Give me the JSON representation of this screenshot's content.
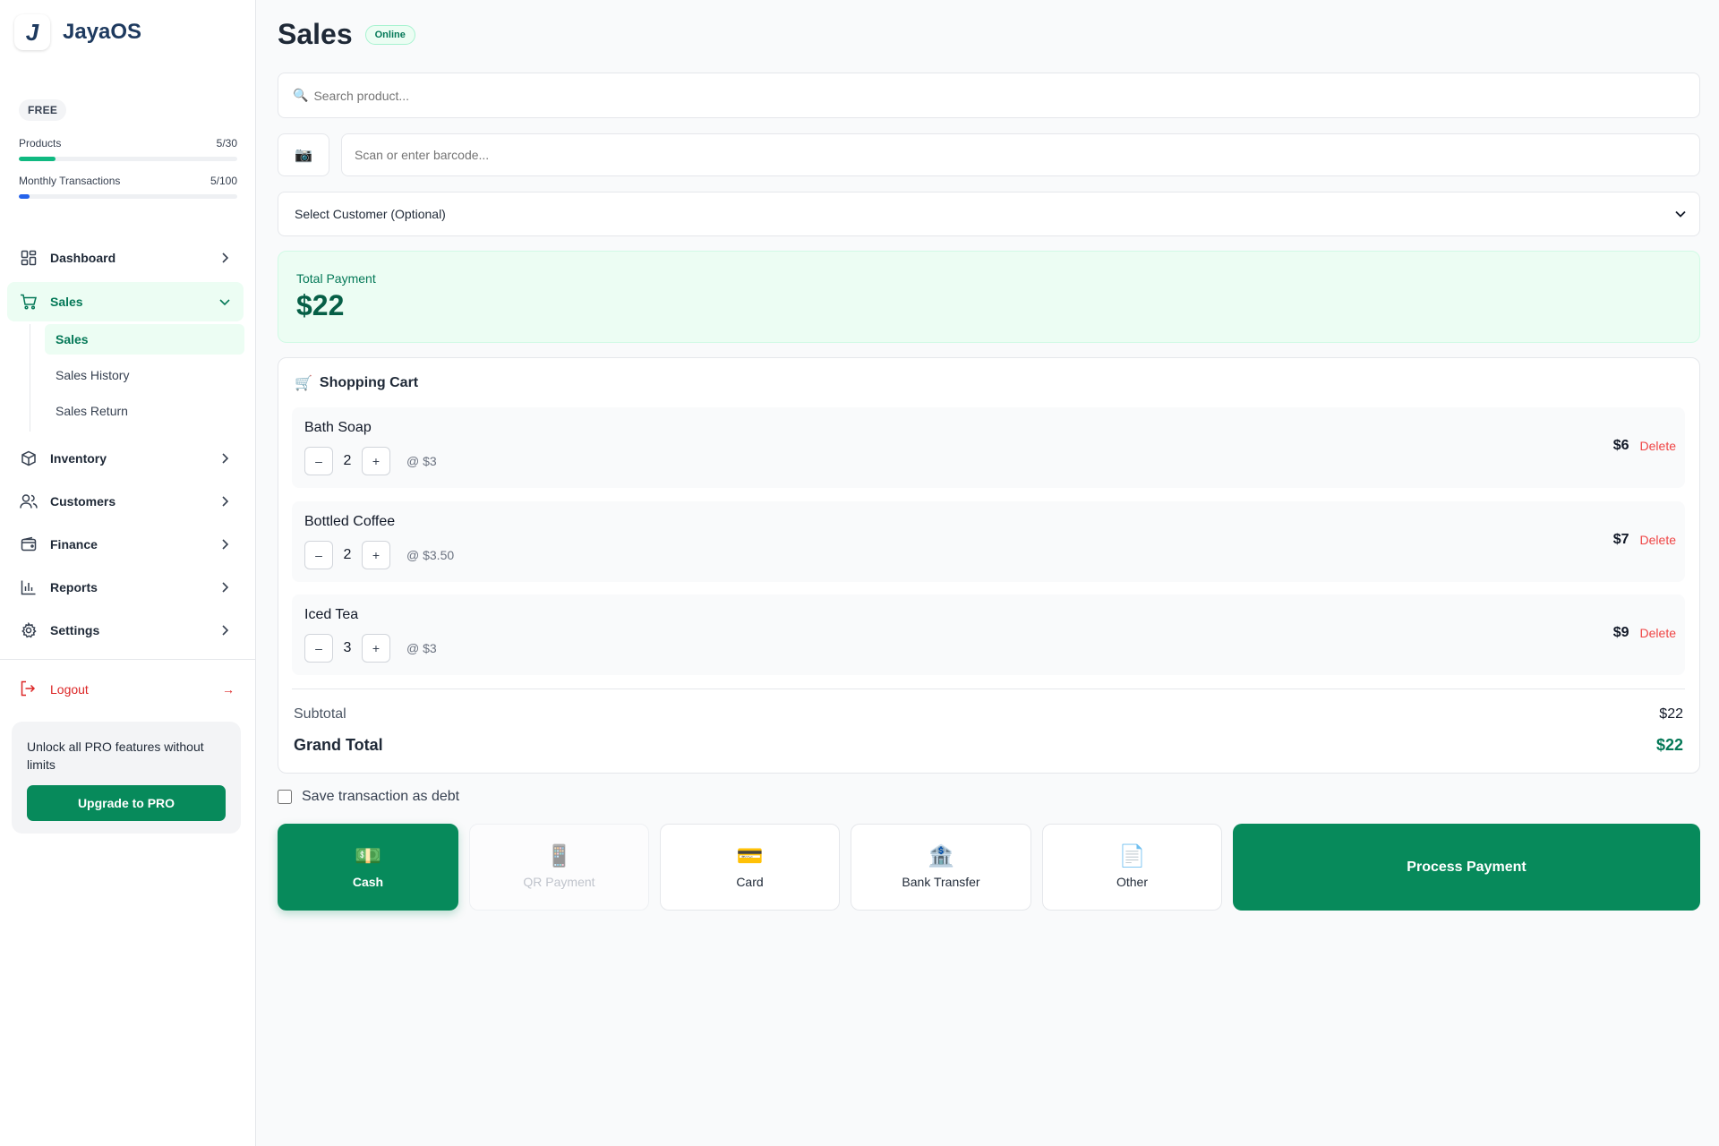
{
  "app": {
    "name": "JayaOS",
    "logo_letter": "J"
  },
  "plan": {
    "badge": "FREE",
    "usage": [
      {
        "label": "Products",
        "count": "5/30",
        "fraction": 0.1667,
        "color": "#10b981"
      },
      {
        "label": "Monthly Transactions",
        "count": "5/100",
        "fraction": 0.05,
        "color": "#2563eb"
      }
    ]
  },
  "nav": {
    "items": [
      {
        "label": "Dashboard",
        "icon": "grid-icon"
      },
      {
        "label": "Sales",
        "icon": "cart-icon",
        "active": true,
        "expanded": true
      },
      {
        "label": "Inventory",
        "icon": "package-icon"
      },
      {
        "label": "Customers",
        "icon": "users-icon"
      },
      {
        "label": "Finance",
        "icon": "wallet-icon"
      },
      {
        "label": "Reports",
        "icon": "bar-chart-icon"
      },
      {
        "label": "Settings",
        "icon": "gear-icon"
      }
    ],
    "sales_sub": [
      {
        "label": "Sales",
        "active": true
      },
      {
        "label": "Sales History"
      },
      {
        "label": "Sales Return"
      }
    ],
    "logout": "Logout",
    "logout_arrow": "→"
  },
  "promo": {
    "text": "Unlock all PRO features without limits",
    "button": "Upgrade to PRO"
  },
  "page": {
    "title": "Sales",
    "status": "Online"
  },
  "search": {
    "icon": "🔍",
    "placeholder": "Search product..."
  },
  "barcode": {
    "icon": "📷",
    "placeholder": "Scan or enter barcode..."
  },
  "customer": {
    "placeholder": "Select Customer (Optional)"
  },
  "total": {
    "label": "Total Payment",
    "amount": "$22"
  },
  "cart": {
    "title": "Shopping Cart",
    "icon": "🛒",
    "items": [
      {
        "name": "Bath Soap",
        "qty": "2",
        "unit_price": "@ $3",
        "total": "$6",
        "delete": "Delete",
        "minus": "–",
        "plus": "+"
      },
      {
        "name": "Bottled Coffee",
        "qty": "2",
        "unit_price": "@ $3.50",
        "total": "$7",
        "delete": "Delete",
        "minus": "–",
        "plus": "+"
      },
      {
        "name": "Iced Tea",
        "qty": "3",
        "unit_price": "@ $3",
        "total": "$9",
        "delete": "Delete",
        "minus": "–",
        "plus": "+"
      }
    ],
    "subtotal_label": "Subtotal",
    "subtotal": "$22",
    "grand_total_label": "Grand Total",
    "grand_total": "$22"
  },
  "debt": {
    "label": "Save transaction as debt",
    "checked": false
  },
  "payment_methods": [
    {
      "label": "Cash",
      "icon": "💵",
      "state": "selected"
    },
    {
      "label": "QR Payment",
      "icon": "📱",
      "state": "disabled"
    },
    {
      "label": "Card",
      "icon": "💳",
      "state": "normal"
    },
    {
      "label": "Bank Transfer",
      "icon": "🏦",
      "state": "normal"
    },
    {
      "label": "Other",
      "icon": "📄",
      "state": "normal"
    }
  ],
  "process_button": "Process Payment",
  "colors": {
    "brand": "#078a5b",
    "brand_light": "#ecfdf3",
    "danger": "#ef4444",
    "navy": "#1e3a5f"
  }
}
